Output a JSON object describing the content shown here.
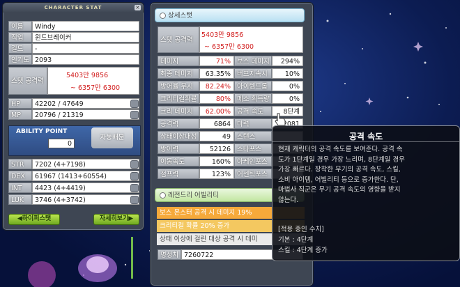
{
  "left_panel": {
    "title": "CHARACTER STAT",
    "close_label": "×",
    "rows": [
      {
        "label": "이름",
        "value": "Windy"
      },
      {
        "label": "직업",
        "value": "윈드브레이커"
      },
      {
        "label": "길드",
        "value": "-"
      },
      {
        "label": "인기도",
        "value": "2093"
      }
    ],
    "stat_attack": {
      "label": "스탯 공격력",
      "line1": "5403만 9856",
      "line2": "~ 6357만 6300"
    },
    "hp": {
      "label": "HP",
      "value": "42202 / 47649"
    },
    "mp": {
      "label": "MP",
      "value": "20796 / 21319"
    },
    "ability_point": {
      "label": "ABILITY POINT",
      "value": "0",
      "auto_button": "자동배분"
    },
    "stats": [
      {
        "label": "STR",
        "value": "7202 (4+7198)"
      },
      {
        "label": "DEX",
        "value": "61967 (1413+60554)"
      },
      {
        "label": "INT",
        "value": "4423 (4+4419)"
      },
      {
        "label": "LUK",
        "value": "3746 (4+3742)"
      }
    ],
    "hyper_button": "◀하이퍼스탯",
    "detail_button": "자세히보기▶"
  },
  "right_panel": {
    "detail_header": "상세스탯",
    "stat_attack": {
      "label": "스탯 공격력",
      "line1": "5403만 9856",
      "line2": "~ 6357만 6300"
    },
    "pairs": [
      {
        "l1": "데미지",
        "v1": "71%",
        "l2": "보스 데미지",
        "v2": "294%"
      },
      {
        "l1": "최종 데미지",
        "v1": "63.35%",
        "l2": "버프지속시간",
        "v2": "10%"
      },
      {
        "l1": "방어율 무시",
        "v1": "82.24%",
        "l2": "아이템드롭률",
        "v2": "0%"
      },
      {
        "l1": "크리티컬확률",
        "v1": "80%",
        "l2": "메소 획득량",
        "v2": "0%"
      },
      {
        "l1": "크리 데미지",
        "v1": "62.00%",
        "l2": "공격 속도",
        "v2": "8단계"
      },
      {
        "l1": "공격력",
        "v1": "6864",
        "l2": "마력",
        "v2": "2081"
      },
      {
        "l1": "상태이상내성",
        "v1": "49",
        "l2": "스탠스",
        "v2": ""
      },
      {
        "l1": "방어력",
        "v1": "52126",
        "l2": "스타포스",
        "v2": ""
      },
      {
        "l1": "이동속도",
        "v1": "160%",
        "l2": "아케인포스",
        "v2": ""
      },
      {
        "l1": "점프력",
        "v1": "123%",
        "l2": "어센틱포스",
        "v2": ""
      }
    ],
    "legendary_header": "레전드리 어빌리티",
    "legendary_lines": [
      "보스 몬스터 공격 시 데미지 19%",
      "크리티컬 확률 20% 증가",
      "상태 이상에 걸린 대상 공격 시 데미"
    ],
    "fame": {
      "label": "명성치",
      "value": "7260722"
    }
  },
  "tooltip": {
    "title": "공격 속도",
    "desc": [
      "현재 캐릭터의 공격 속도를 보여준다. 공격 속",
      "도가 1단계일 경우 가장 느리며, 8단계일 경우",
      "가장 빠르다. 장착한 무기의 공격 속도, 스킬,",
      "소비 아이템, 어빌리티 등으로 증가한다. 단,",
      "마법사 직군은 무기 공격 속도의 영향을 받지",
      "않는다."
    ],
    "apply_header": "[적용 중인 수치]",
    "apply_lines": [
      "기본 : 4단계",
      "스킬 : 4단계 증가"
    ]
  },
  "colors": {
    "red_value": "#d21f1f",
    "panel": "#3e4653"
  }
}
